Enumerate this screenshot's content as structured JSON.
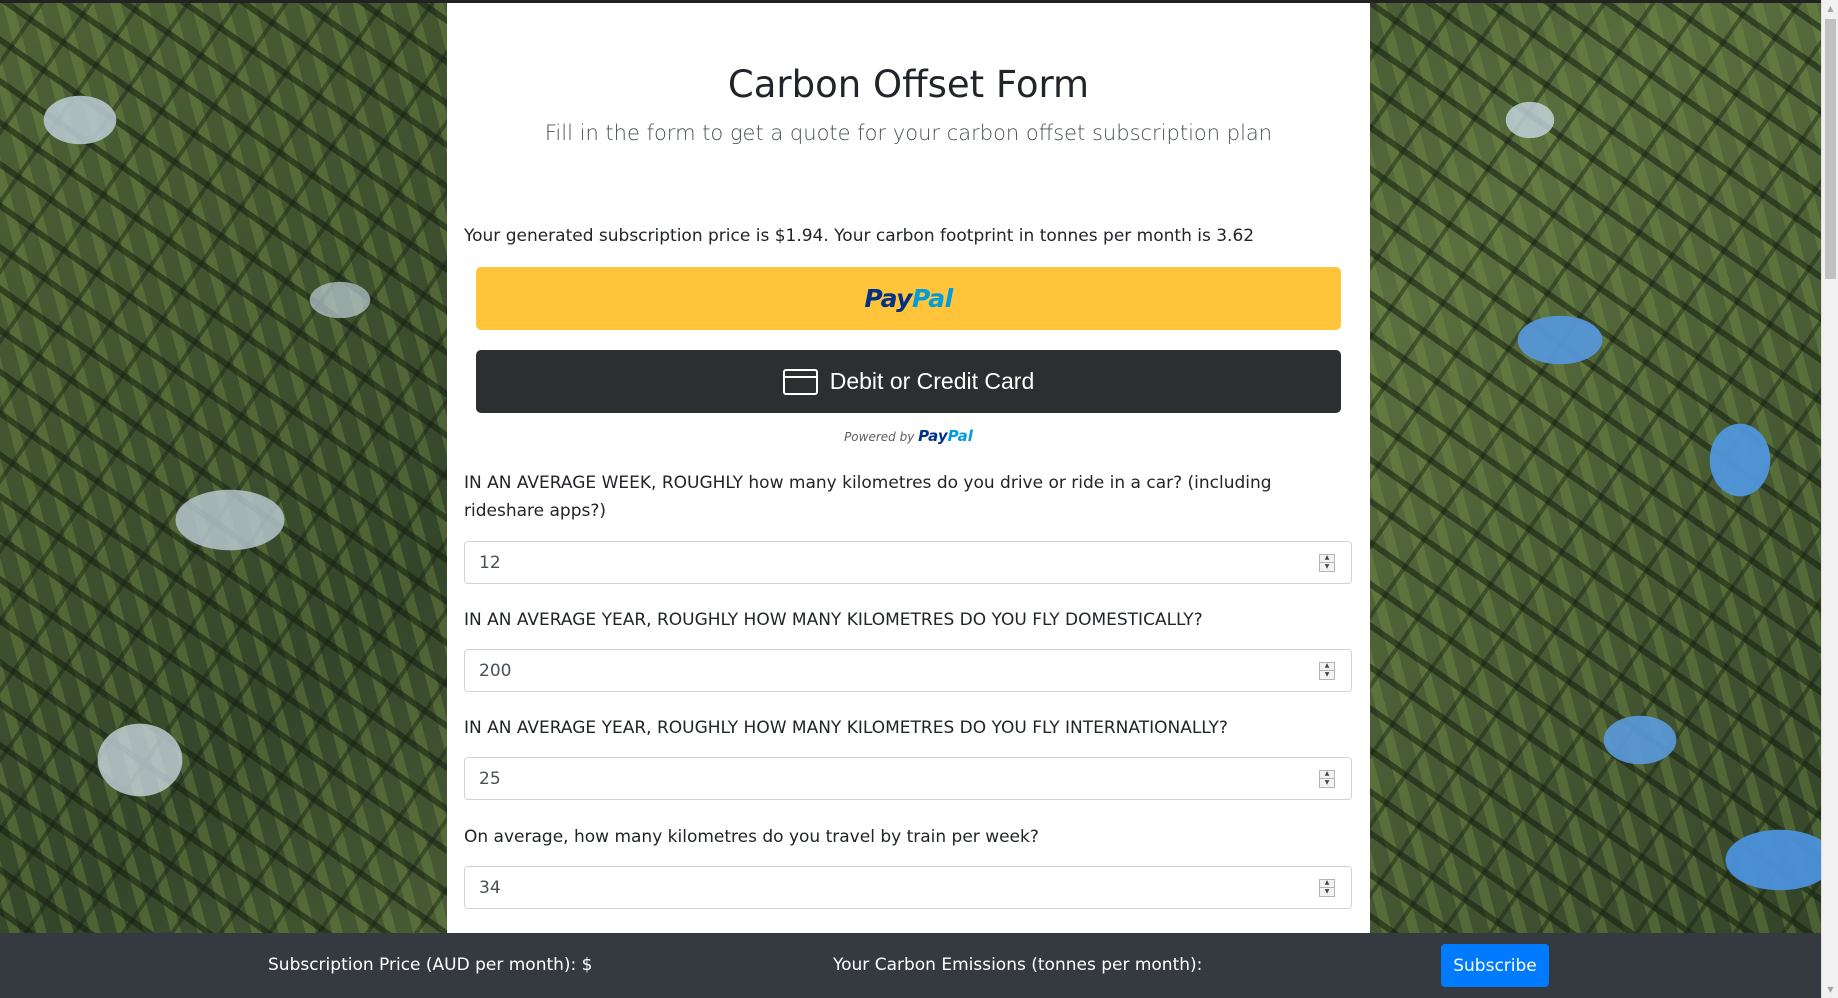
{
  "form": {
    "title": "Carbon Offset Form",
    "subtitle": "Fill in the form to get a quote for your carbon offset subscription plan",
    "result_text": "Your generated subscription price is $1.94. Your carbon footprint in tonnes per month is 3.62"
  },
  "payment": {
    "paypal_pay": "Pay",
    "paypal_pal": "Pal",
    "card_label": "Debit or Credit Card",
    "powered_by": "Powered by",
    "powered_pay": "Pay",
    "powered_pal": "Pal"
  },
  "questions": [
    {
      "label": "IN AN AVERAGE WEEK, ROUGHLY how many kilometres do you drive or ride in a car? (including rideshare apps?)",
      "value": "12"
    },
    {
      "label": "IN AN AVERAGE YEAR, ROUGHLY HOW MANY KILOMETRES DO YOU FLY DOMESTICALLY?",
      "value": "200"
    },
    {
      "label": "IN AN AVERAGE YEAR, ROUGHLY HOW MANY KILOMETRES DO YOU FLY INTERNATIONALLY?",
      "value": "25"
    },
    {
      "label": "On average, how many kilometres do you travel by train per week?",
      "value": "34"
    }
  ],
  "footer": {
    "price_label": "Subscription Price (AUD per month): $",
    "emissions_label": "Your Carbon Emissions (tonnes per month):",
    "subscribe_label": "Subscribe"
  },
  "colors": {
    "paypal_yellow": "#ffc439",
    "card_dark": "#2c2e2f",
    "footer_bg": "#343a40",
    "subscribe_blue": "#007bff"
  }
}
